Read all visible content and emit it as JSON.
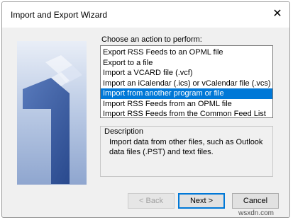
{
  "window": {
    "title": "Import and Export Wizard",
    "close_glyph": "✕"
  },
  "action_label": "Choose an action to perform:",
  "actions": [
    "Export RSS Feeds to an OPML file",
    "Export to a file",
    "Import a VCARD file (.vcf)",
    "Import an iCalendar (.ics) or vCalendar file (.vcs)",
    "Import from another program or file",
    "Import RSS Feeds from an OPML file",
    "Import RSS Feeds from the Common Feed List"
  ],
  "selected_action": "Import from another program or file",
  "description": {
    "title": "Description",
    "text": "Import data from other files, such as Outlook data files (.PST) and text files."
  },
  "buttons": {
    "back": "< Back",
    "next": "Next >",
    "cancel": "Cancel"
  },
  "watermark": "wsxdn.com",
  "colors": {
    "selection": "#0078d7",
    "window_bg": "#f0f0f0"
  }
}
